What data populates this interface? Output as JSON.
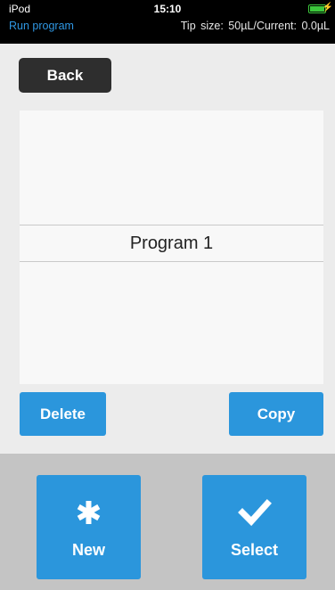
{
  "status_bar": {
    "device": "iPod",
    "time": "15:10"
  },
  "info_bar": {
    "mode": "Run program",
    "tip_info": "Tip size: 50µL/Current: 0.0µL"
  },
  "back_button": {
    "label": "Back"
  },
  "program_list": {
    "items": [
      "Program 1"
    ]
  },
  "actions": {
    "delete_label": "Delete",
    "copy_label": "Copy"
  },
  "bottom_actions": {
    "new_label": "New",
    "select_label": "Select"
  },
  "colors": {
    "accent": "#2b96dc",
    "mode_text": "#2f97e3",
    "battery": "#3cc83c"
  }
}
